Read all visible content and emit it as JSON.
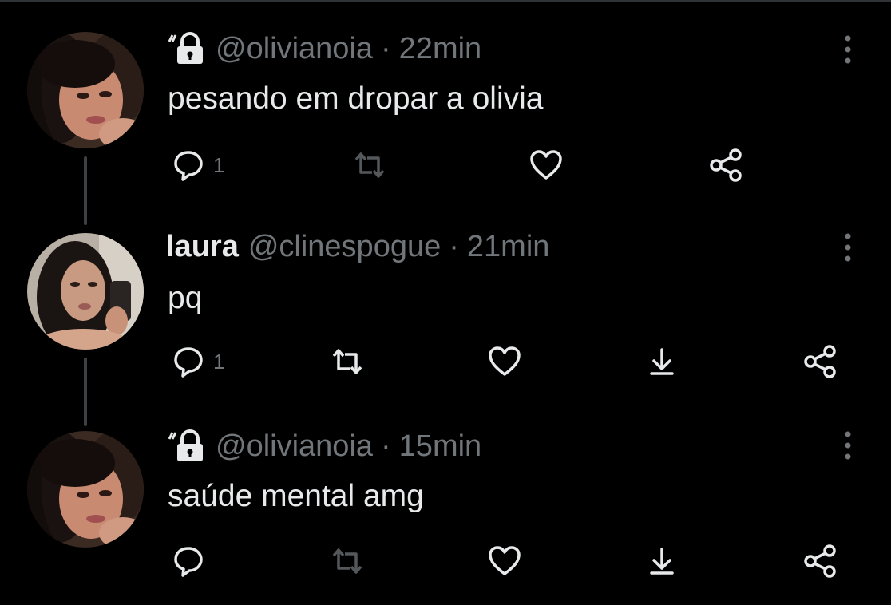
{
  "tweets": [
    {
      "display_name": "",
      "handle": "@olivianoia",
      "time": "22min",
      "protected": true,
      "text": "pesando em dropar a olivia",
      "reply_count": "1"
    },
    {
      "display_name": "laura",
      "handle": "@clinespogue",
      "time": "21min",
      "protected": false,
      "text": "pq",
      "reply_count": "1"
    },
    {
      "display_name": "",
      "handle": "@olivianoia",
      "time": "15min",
      "protected": true,
      "text": "saúde mental amg",
      "reply_count": ""
    }
  ],
  "separator": "·",
  "colors": {
    "background": "#000000",
    "text_primary": "#e7e9ea",
    "text_secondary": "#71767b",
    "thread_line": "#3e4144"
  },
  "icons": [
    "lock-icon",
    "reply-icon",
    "retweet-icon",
    "like-icon",
    "bookmark-icon",
    "share-icon",
    "more-icon"
  ]
}
